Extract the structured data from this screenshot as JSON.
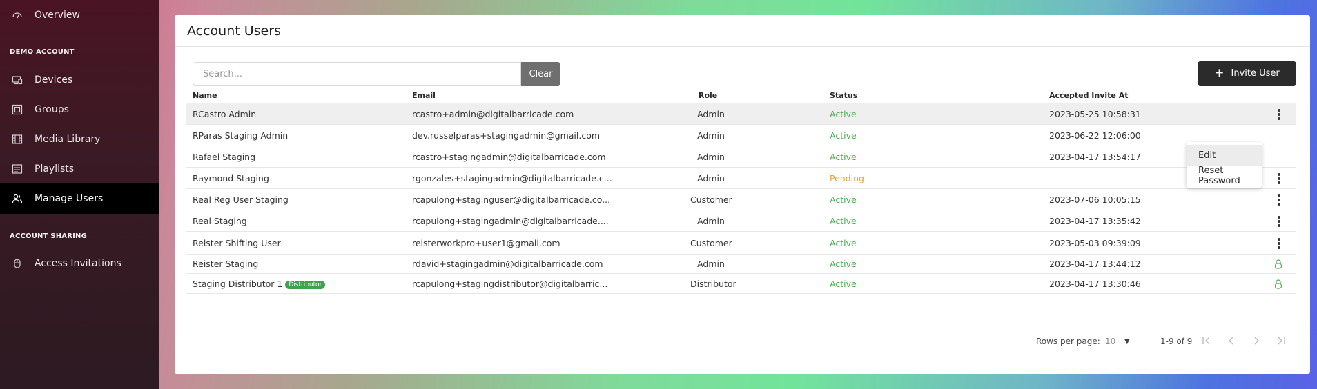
{
  "sidebar": {
    "items": [
      {
        "label": "Overview",
        "icon": "dashboard-icon"
      },
      {
        "label": "Devices",
        "icon": "devices-icon"
      },
      {
        "label": "Groups",
        "icon": "groups-icon"
      },
      {
        "label": "Media Library",
        "icon": "film-icon"
      },
      {
        "label": "Playlists",
        "icon": "playlist-icon"
      },
      {
        "label": "Manage Users",
        "icon": "users-icon"
      },
      {
        "label": "Access Invitations",
        "icon": "mouse-icon"
      }
    ],
    "sections": {
      "demo_account": "DEMO ACCOUNT",
      "account_sharing": "ACCOUNT SHARING"
    }
  },
  "page": {
    "title": "Account Users"
  },
  "search": {
    "placeholder": "Search...",
    "value": "",
    "clear_label": "Clear"
  },
  "invite": {
    "label": "Invite User"
  },
  "table": {
    "columns": [
      "Name",
      "Email",
      "Role",
      "Status",
      "Accepted Invite At"
    ],
    "rows": [
      {
        "name": "RCastro Admin",
        "email": "rcastro+admin@digitalbarricade.com",
        "role": "Admin",
        "status": "Active",
        "accepted": "2023-05-25 10:58:31",
        "action": "kebab"
      },
      {
        "name": "RParas Staging Admin",
        "email": "dev.russelparas+stagingadmin@gmail.com",
        "role": "Admin",
        "status": "Active",
        "accepted": "2023-06-22 12:06:00",
        "action": "none"
      },
      {
        "name": "Rafael Staging",
        "email": "rcastro+stagingadmin@digitalbarricade.com",
        "role": "Admin",
        "status": "Active",
        "accepted": "2023-04-17 13:54:17",
        "action": "none"
      },
      {
        "name": "Raymond Staging",
        "email": "rgonzales+stagingadmin@digitalbarricade.c...",
        "role": "Admin",
        "status": "Pending",
        "accepted": "",
        "action": "kebab"
      },
      {
        "name": "Real Reg User Staging",
        "email": "rcapulong+staginguser@digitalbarricade.co...",
        "role": "Customer",
        "status": "Active",
        "accepted": "2023-07-06 10:05:15",
        "action": "kebab"
      },
      {
        "name": "Real Staging",
        "email": "rcapulong+stagingadmin@digitalbarricade....",
        "role": "Admin",
        "status": "Active",
        "accepted": "2023-04-17 13:35:42",
        "action": "kebab"
      },
      {
        "name": "Reister Shifting User",
        "email": "reisterworkpro+user1@gmail.com",
        "role": "Customer",
        "status": "Active",
        "accepted": "2023-05-03 09:39:09",
        "action": "kebab"
      },
      {
        "name": "Reister Staging",
        "email": "rdavid+stagingadmin@digitalbarricade.com",
        "role": "Admin",
        "status": "Active",
        "accepted": "2023-04-17 13:44:12",
        "action": "lock"
      },
      {
        "name": "Staging Distributor 1",
        "badge": "Distributor",
        "email": "rcapulong+stagingdistributor@digitalbarric...",
        "role": "Distributor",
        "status": "Active",
        "accepted": "2023-04-17 13:30:46",
        "action": "lock"
      }
    ]
  },
  "row_menu": {
    "edit": "Edit",
    "reset_password": "Reset Password"
  },
  "pagination": {
    "rows_per_page_label": "Rows per page:",
    "rows_per_page": "10",
    "range": "1-9 of 9"
  },
  "colors": {
    "active": "#4caf50",
    "pending": "#f0a030",
    "badge": "#3fa24f"
  }
}
